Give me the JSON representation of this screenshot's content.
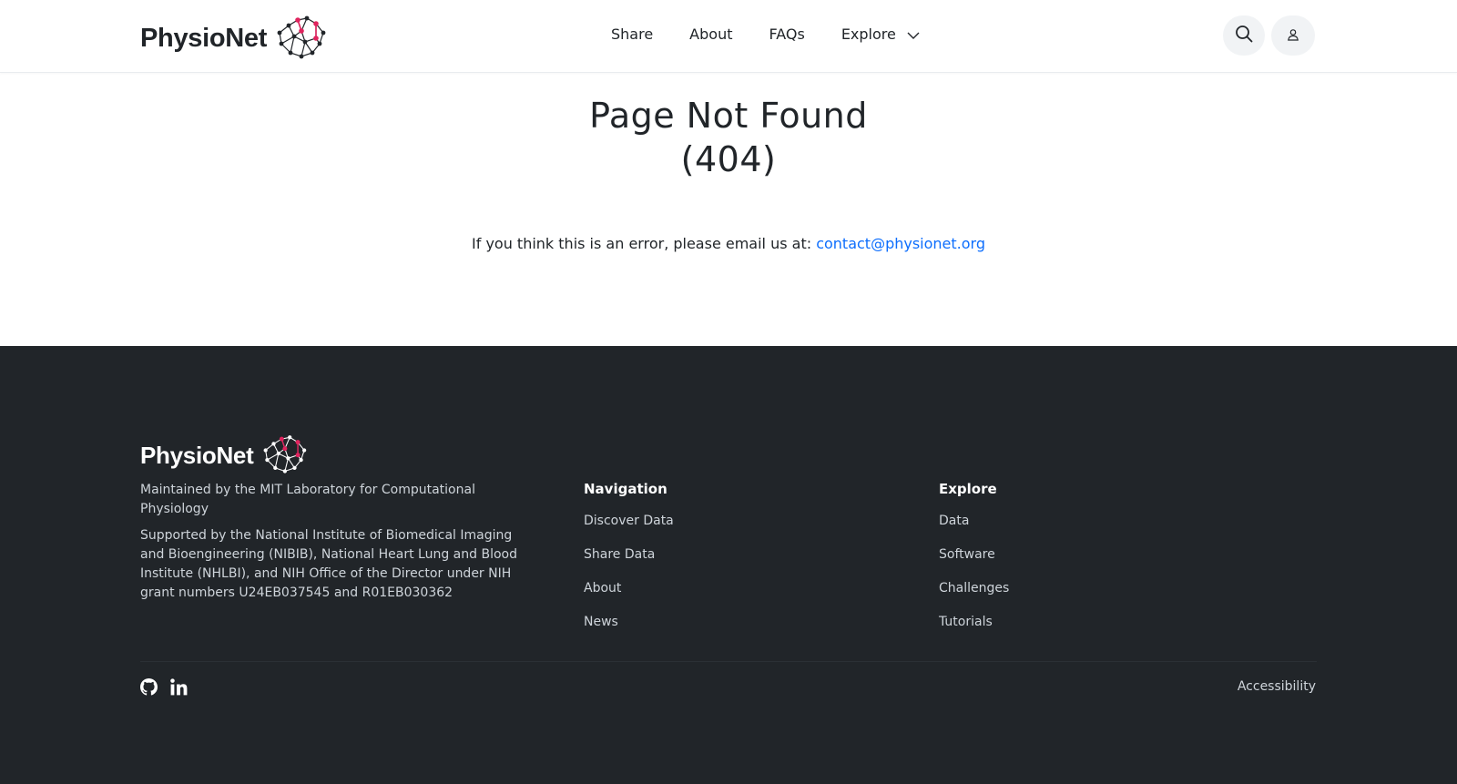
{
  "header": {
    "logo_text": "PhysioNet",
    "nav": [
      {
        "label": "Share"
      },
      {
        "label": "About"
      },
      {
        "label": "FAQs"
      },
      {
        "label": "Explore"
      }
    ]
  },
  "main": {
    "title_line1": "Page Not Found",
    "title_line2": "(404)",
    "message": "If you think this is an error, please email us at: ",
    "email": "contact@physionet.org"
  },
  "footer": {
    "logo_text": "PhysioNet",
    "maintained": "Maintained by the MIT Laboratory for Computational Physiology",
    "supported": "Supported by the National Institute of Biomedical Imaging and Bioengineering (NIBIB), National Heart Lung and Blood Institute (NHLBI), and NIH Office of the Director under NIH grant numbers U24EB037545 and R01EB030362",
    "navigation": {
      "heading": "Navigation",
      "links": [
        "Discover Data",
        "Share Data",
        "About",
        "News"
      ]
    },
    "explore": {
      "heading": "Explore",
      "links": [
        "Data",
        "Software",
        "Challenges",
        "Tutorials"
      ]
    },
    "accessibility": "Accessibility"
  },
  "colors": {
    "link": "#0d6efd",
    "footer_bg": "#212529",
    "logo_accent": "#e0245e"
  },
  "icons": [
    "network-logo-icon",
    "search-icon",
    "user-icon",
    "chevron-down-icon",
    "github-icon",
    "linkedin-icon"
  ]
}
